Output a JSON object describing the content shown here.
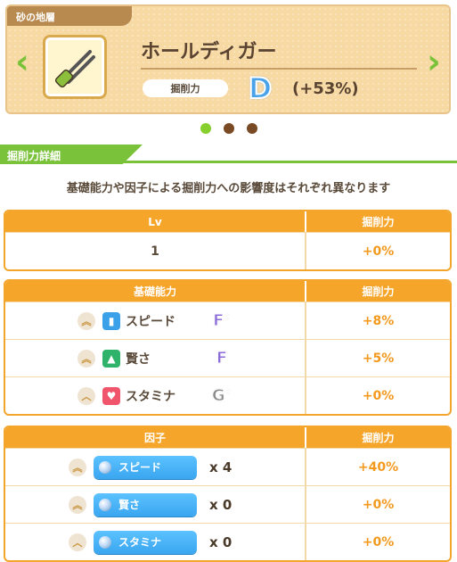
{
  "header": {
    "tag": "砂の地層",
    "title": "ホールディガー",
    "stat_label": "掘削力",
    "grade": "D",
    "percent": "(+53%)",
    "prev_icon": "chevron-left-icon",
    "next_icon": "chevron-right-icon",
    "item_icon": "pliers-tool-icon"
  },
  "pagination": {
    "count": 3,
    "active": 0
  },
  "section": {
    "title": "掘削力詳細",
    "subtitle": "基礎能力や因子による掘削力への影響度はそれぞれ異なります"
  },
  "lv_table": {
    "col1": "Lv",
    "col2": "掘削力",
    "rows": [
      {
        "lv": "1",
        "value": "+0%"
      }
    ]
  },
  "base_table": {
    "col1": "基礎能力",
    "col2": "掘削力",
    "rows": [
      {
        "name": "スピード",
        "grade": "F",
        "grade_suffix": "+",
        "value": "+8%",
        "icon": "shoe-icon",
        "icon_color": "#3aa0e8"
      },
      {
        "name": "賢さ",
        "grade": "F",
        "grade_suffix": "",
        "value": "+5%",
        "icon": "graduation-cap-icon",
        "icon_color": "#2fb36a"
      },
      {
        "name": "スタミナ",
        "grade": "G",
        "grade_suffix": "+",
        "value": "+0%",
        "icon": "heart-icon",
        "icon_color": "#f0556b"
      }
    ]
  },
  "factor_table": {
    "col1": "因子",
    "col2": "掘削力",
    "rows": [
      {
        "name": "スピード",
        "mult": "x 4",
        "value": "+40%"
      },
      {
        "name": "賢さ",
        "mult": "x 0",
        "value": "+0%"
      },
      {
        "name": "スタミナ",
        "mult": "x 0",
        "value": "+0%"
      }
    ]
  },
  "colors": {
    "accent_green": "#7ac23a",
    "accent_orange": "#f6a52b",
    "value_orange": "#f39a1e",
    "grade_blue": "#4aa3e8",
    "grade_purple": "#8a6ad9"
  }
}
